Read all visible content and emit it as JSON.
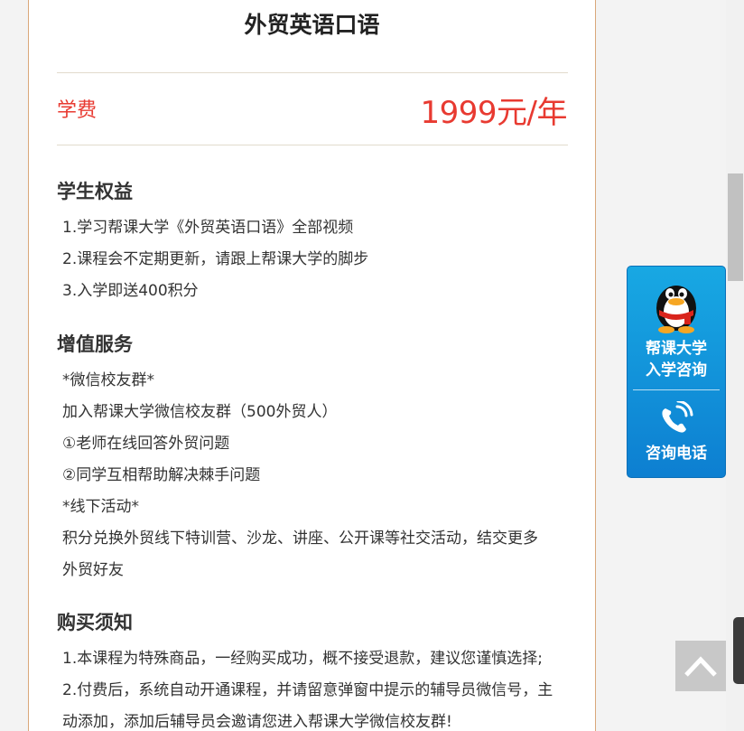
{
  "course": {
    "title": "外贸英语口语",
    "fee_label": "学费",
    "fee_price": "1999元/年"
  },
  "sections": {
    "benefits": {
      "title": "学生权益",
      "lines": [
        "1.学习帮课大学《外贸英语口语》全部视频",
        "2.课程会不定期更新，请跟上帮课大学的脚步",
        "3.入学即送400积分"
      ]
    },
    "services": {
      "title": "增值服务",
      "lines": [
        "*微信校友群*",
        "加入帮课大学微信校友群（500外贸人）",
        "①老师在线回答外贸问题",
        "②同学互相帮助解决棘手问题",
        "*线下活动*",
        "积分兑换外贸线下特训营、沙龙、讲座、公开课等社交活动，结交更多",
        "外贸好友"
      ]
    },
    "notice": {
      "title": "购买须知",
      "lines": [
        "1.本课程为特殊商品，一经购买成功，概不接受退款，建议您谨慎选择;",
        "2.付费后，系统自动开通课程，并请留意弹窗中提示的辅导员微信号，主",
        "动添加，添加后辅导员会邀请您进入帮课大学微信校友群!"
      ]
    }
  },
  "sidebar_widget": {
    "qq_label_line1": "帮课大学",
    "qq_label_line2": "入学咨询",
    "phone_label": "咨询电话",
    "qq_icon": "qq-penguin-icon",
    "phone_icon": "phone-icon"
  },
  "colors": {
    "price_red": "#e83a31",
    "widget_blue": "#0d7fd1",
    "card_border": "#d9a77a"
  }
}
